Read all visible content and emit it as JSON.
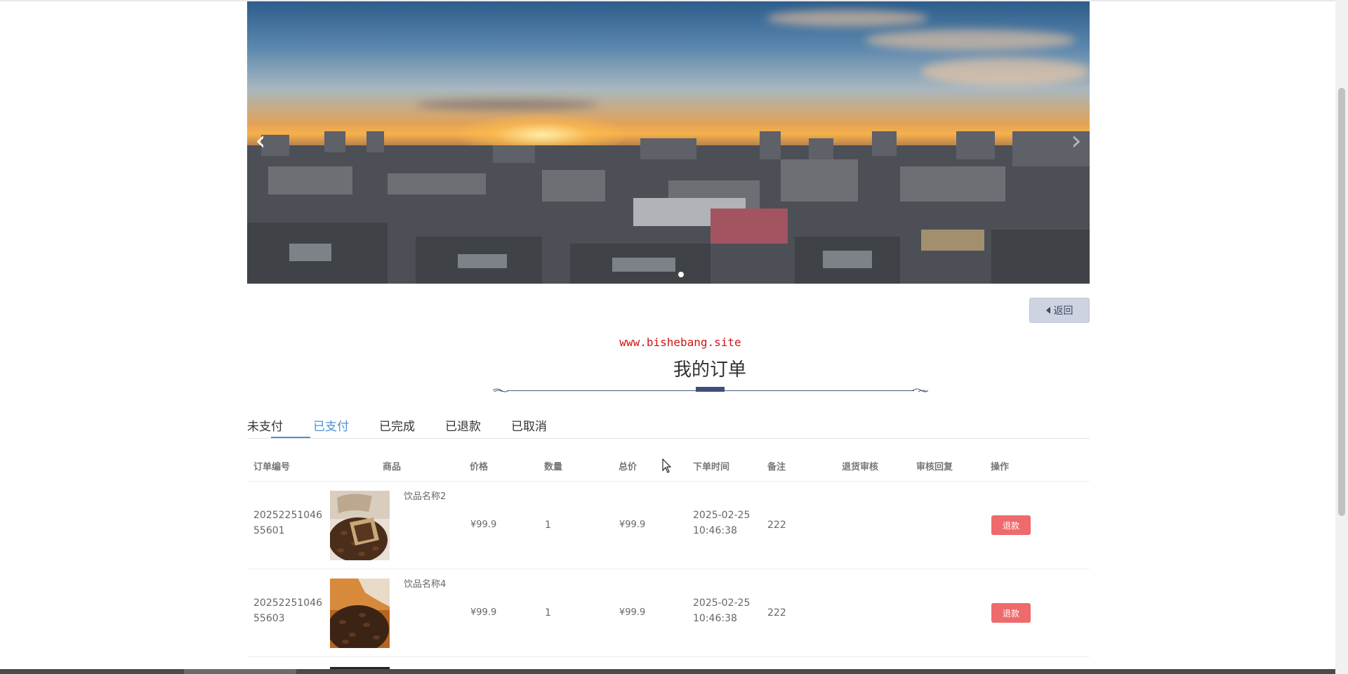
{
  "banner": {
    "prev_arrow": "‹",
    "next_arrow": "›"
  },
  "back_button": {
    "label": "返回"
  },
  "watermark": "www.bishebang.site",
  "page_title": "我的订单",
  "tabs": [
    {
      "label": "未支付",
      "active": false
    },
    {
      "label": "已支付",
      "active": true
    },
    {
      "label": "已完成",
      "active": false
    },
    {
      "label": "已退款",
      "active": false
    },
    {
      "label": "已取消",
      "active": false
    }
  ],
  "table": {
    "headers": {
      "order_no": "订单编号",
      "product": "商品",
      "price": "价格",
      "qty": "数量",
      "total": "总价",
      "order_time": "下单时间",
      "remark": "备注",
      "return_review": "退货审核",
      "review_reply": "审核回复",
      "actions": "操作"
    },
    "rows": [
      {
        "order_no": "2025225104655601",
        "product_name": "饮品名称2",
        "price": "¥99.9",
        "qty": "1",
        "total": "¥99.9",
        "order_time": "2025-02-25 10:46:38",
        "remark": "222",
        "action": "退款"
      },
      {
        "order_no": "2025225104655603",
        "product_name": "饮品名称4",
        "price": "¥99.9",
        "qty": "1",
        "total": "¥99.9",
        "order_time": "2025-02-25 10:46:38",
        "remark": "222",
        "action": "退款"
      }
    ]
  },
  "colors": {
    "accent": "#4a90d6",
    "danger": "#ef6a6c",
    "watermark": "#d01515",
    "back_button_bg": "#cdd3e1"
  }
}
